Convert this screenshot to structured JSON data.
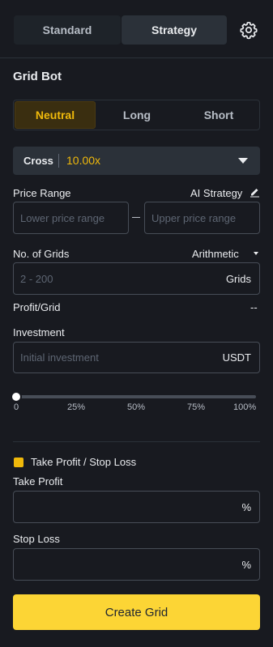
{
  "tabs": {
    "standard": "Standard",
    "strategy": "Strategy"
  },
  "icons": {
    "settings": "gear-icon",
    "edit": "pencil-icon",
    "caret": "caret-down-icon"
  },
  "title": "Grid Bot",
  "modes": {
    "neutral": "Neutral",
    "long": "Long",
    "short": "Short",
    "selected": "Neutral"
  },
  "margin": {
    "mode": "Cross",
    "leverage": "10.00x"
  },
  "price_range": {
    "label": "Price Range",
    "ai_strategy": "AI Strategy",
    "lower_placeholder": "Lower price range",
    "upper_placeholder": "Upper price range",
    "separator": "—"
  },
  "grids": {
    "label": "No. of Grids",
    "type": "Arithmetic",
    "placeholder": "2 - 200",
    "unit": "Grids"
  },
  "profit_grid": {
    "label": "Profit/Grid",
    "value": "--"
  },
  "investment": {
    "label": "Investment",
    "placeholder": "Initial investment",
    "unit": "USDT"
  },
  "slider": {
    "value_percent": 0,
    "ticks": [
      "0",
      "25%",
      "50%",
      "75%",
      "100%"
    ]
  },
  "tpsl": {
    "checkbox_label": "Take Profit / Stop Loss",
    "checked": true,
    "take_profit_label": "Take Profit",
    "take_profit_unit": "%",
    "stop_loss_label": "Stop Loss",
    "stop_loss_unit": "%"
  },
  "create_button": "Create Grid",
  "colors": {
    "accent": "#f0b90b",
    "button": "#fcd535",
    "background": "#181a20"
  }
}
